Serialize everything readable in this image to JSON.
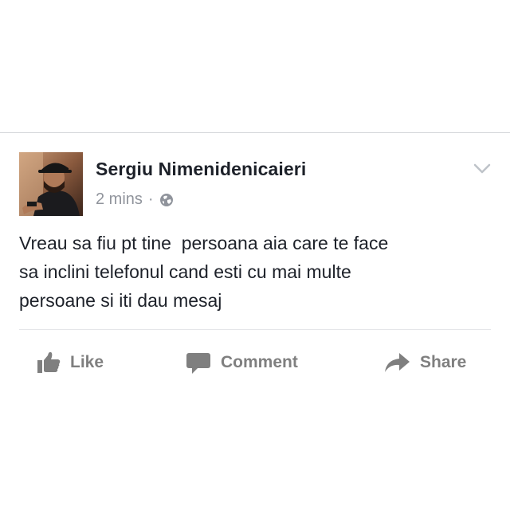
{
  "post": {
    "author": "Sergiu Nimenidenicaieri",
    "time": "2 mins",
    "separator": "·",
    "privacy_icon": "globe-icon",
    "options_icon": "chevron-down-icon",
    "text": "Vreau sa fiu pt tine  persoana aia care te face\nsa inclini telefonul cand esti cu mai multe\npersoane si iti dau mesaj"
  },
  "actions": {
    "like_label": "Like",
    "comment_label": "Comment",
    "share_label": "Share",
    "like_icon": "thumbs-up-icon",
    "comment_icon": "speech-bubble-icon",
    "share_icon": "share-arrow-icon"
  },
  "colors": {
    "name": "#1d2129",
    "meta": "#90949c",
    "action": "#7f7f7f",
    "border": "#d4d6da"
  }
}
